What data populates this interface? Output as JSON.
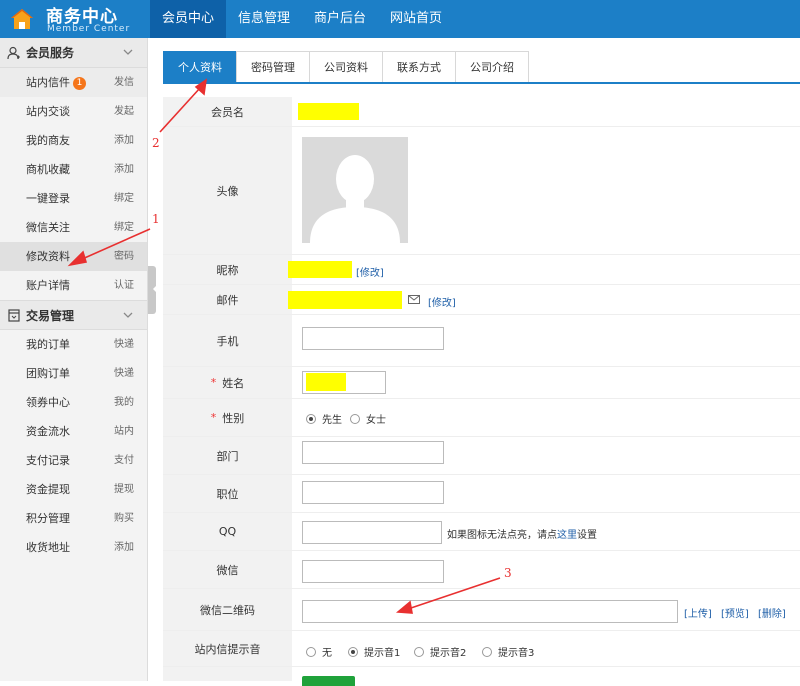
{
  "header": {
    "title": "商务中心",
    "subtitle": "Member Center",
    "nav": [
      {
        "label": "会员中心",
        "active": true
      },
      {
        "label": "信息管理"
      },
      {
        "label": "商户后台"
      },
      {
        "label": "网站首页"
      }
    ]
  },
  "sidebar": {
    "groups": [
      {
        "title": "会员服务",
        "icon": "user-icon",
        "items": [
          {
            "label": "站内信件",
            "action": "发信",
            "badge": "1"
          },
          {
            "label": "站内交谈",
            "action": "发起"
          },
          {
            "label": "我的商友",
            "action": "添加"
          },
          {
            "label": "商机收藏",
            "action": "添加"
          },
          {
            "label": "一键登录",
            "action": "绑定"
          },
          {
            "label": "微信关注",
            "action": "绑定"
          },
          {
            "label": "修改资料",
            "action": "密码",
            "active": true
          },
          {
            "label": "账户详情",
            "action": "认证"
          }
        ]
      },
      {
        "title": "交易管理",
        "icon": "cart-icon",
        "items": [
          {
            "label": "我的订单",
            "action": "快递"
          },
          {
            "label": "团购订单",
            "action": "快递"
          },
          {
            "label": "领券中心",
            "action": "我的"
          },
          {
            "label": "资金流水",
            "action": "站内"
          },
          {
            "label": "支付记录",
            "action": "支付"
          },
          {
            "label": "资金提现",
            "action": "提现"
          },
          {
            "label": "积分管理",
            "action": "购买"
          },
          {
            "label": "收货地址",
            "action": "添加"
          }
        ]
      }
    ]
  },
  "tabs": [
    "个人资料",
    "密码管理",
    "公司资料",
    "联系方式",
    "公司介绍"
  ],
  "form": {
    "member_name": {
      "label": "会员名"
    },
    "avatar": {
      "label": "头像"
    },
    "nickname": {
      "label": "昵称",
      "edit": "[修改]"
    },
    "email": {
      "label": "邮件",
      "edit": "[修改]"
    },
    "mobile": {
      "label": "手机",
      "value": ""
    },
    "realname": {
      "label": "姓名",
      "required": "*"
    },
    "gender": {
      "label": "性别",
      "required": "*",
      "options": [
        "先生",
        "女士"
      ],
      "selected": "先生"
    },
    "department": {
      "label": "部门",
      "value": ""
    },
    "position": {
      "label": "职位",
      "value": ""
    },
    "qq": {
      "label": "QQ",
      "value": "",
      "hint_before": "如果图标无法点亮，请点",
      "hint_link": "这里",
      "hint_after": "设置"
    },
    "wechat": {
      "label": "微信",
      "value": ""
    },
    "wechat_qr": {
      "label": "微信二维码",
      "value": "",
      "upload": "[上传]",
      "preview": "[预览]",
      "delete": "[删除]"
    },
    "notify_sound": {
      "label": "站内信提示音",
      "options": [
        "无",
        "提示音1",
        "提示音2",
        "提示音3"
      ],
      "selected": "提示音1"
    }
  },
  "annotations": [
    "1",
    "2",
    "3"
  ],
  "colors": {
    "brand": "#1c7fc7",
    "brand_dark": "#0e61a8",
    "highlight": "#ffff00",
    "annotation": "#e83030"
  }
}
